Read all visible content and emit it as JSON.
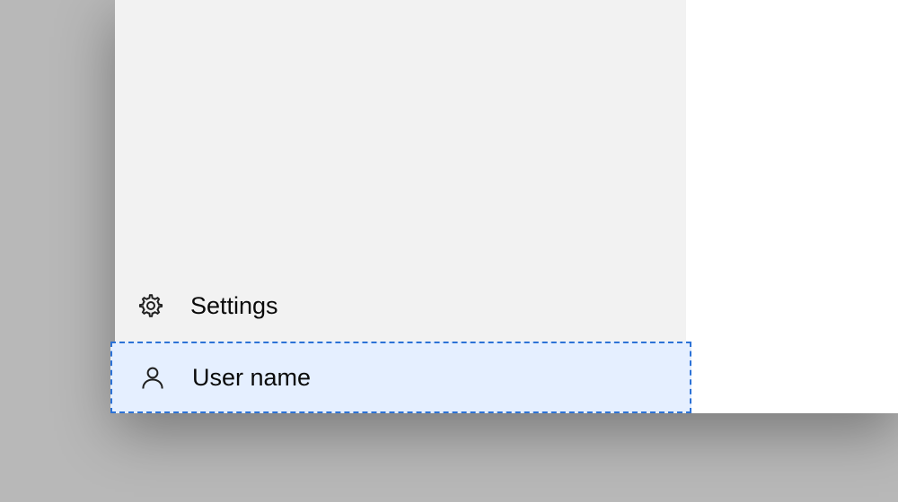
{
  "menu": {
    "settings": {
      "label": "Settings"
    },
    "user": {
      "label": "User name"
    }
  }
}
